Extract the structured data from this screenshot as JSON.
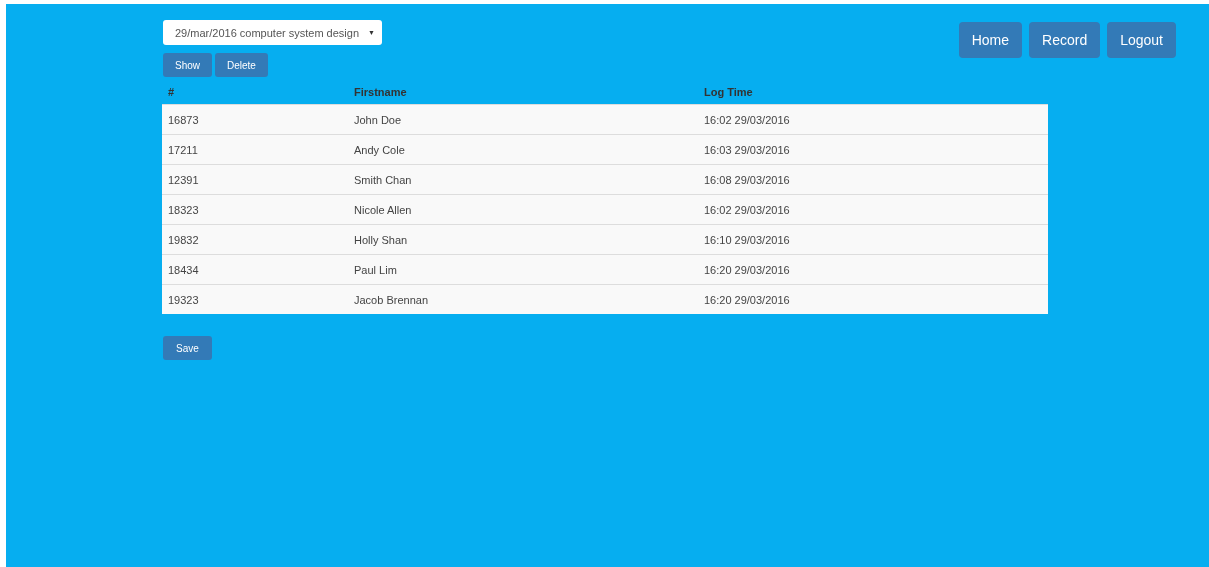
{
  "nav": [
    "Home",
    "Record",
    "Logout"
  ],
  "session_select": {
    "value": "29/mar/2016 computer system design",
    "arrow": "▼"
  },
  "actions": [
    "Show",
    "Delete"
  ],
  "table": {
    "columns": [
      "#",
      "Firstname",
      "Log Time"
    ],
    "rows": [
      [
        "16873",
        "John Doe",
        "16:02 29/03/2016"
      ],
      [
        "17211",
        "Andy Cole",
        "16:03 29/03/2016"
      ],
      [
        "12391",
        "Smith Chan",
        "16:08 29/03/2016"
      ],
      [
        "18323",
        "Nicole Allen",
        "16:02 29/03/2016"
      ],
      [
        "19832",
        "Holly Shan",
        "16:10 29/03/2016"
      ],
      [
        "18434",
        "Paul Lim",
        "16:20 29/03/2016"
      ],
      [
        "19323",
        "Jacob Brennan",
        "16:20 29/03/2016"
      ]
    ]
  },
  "save": "Save"
}
